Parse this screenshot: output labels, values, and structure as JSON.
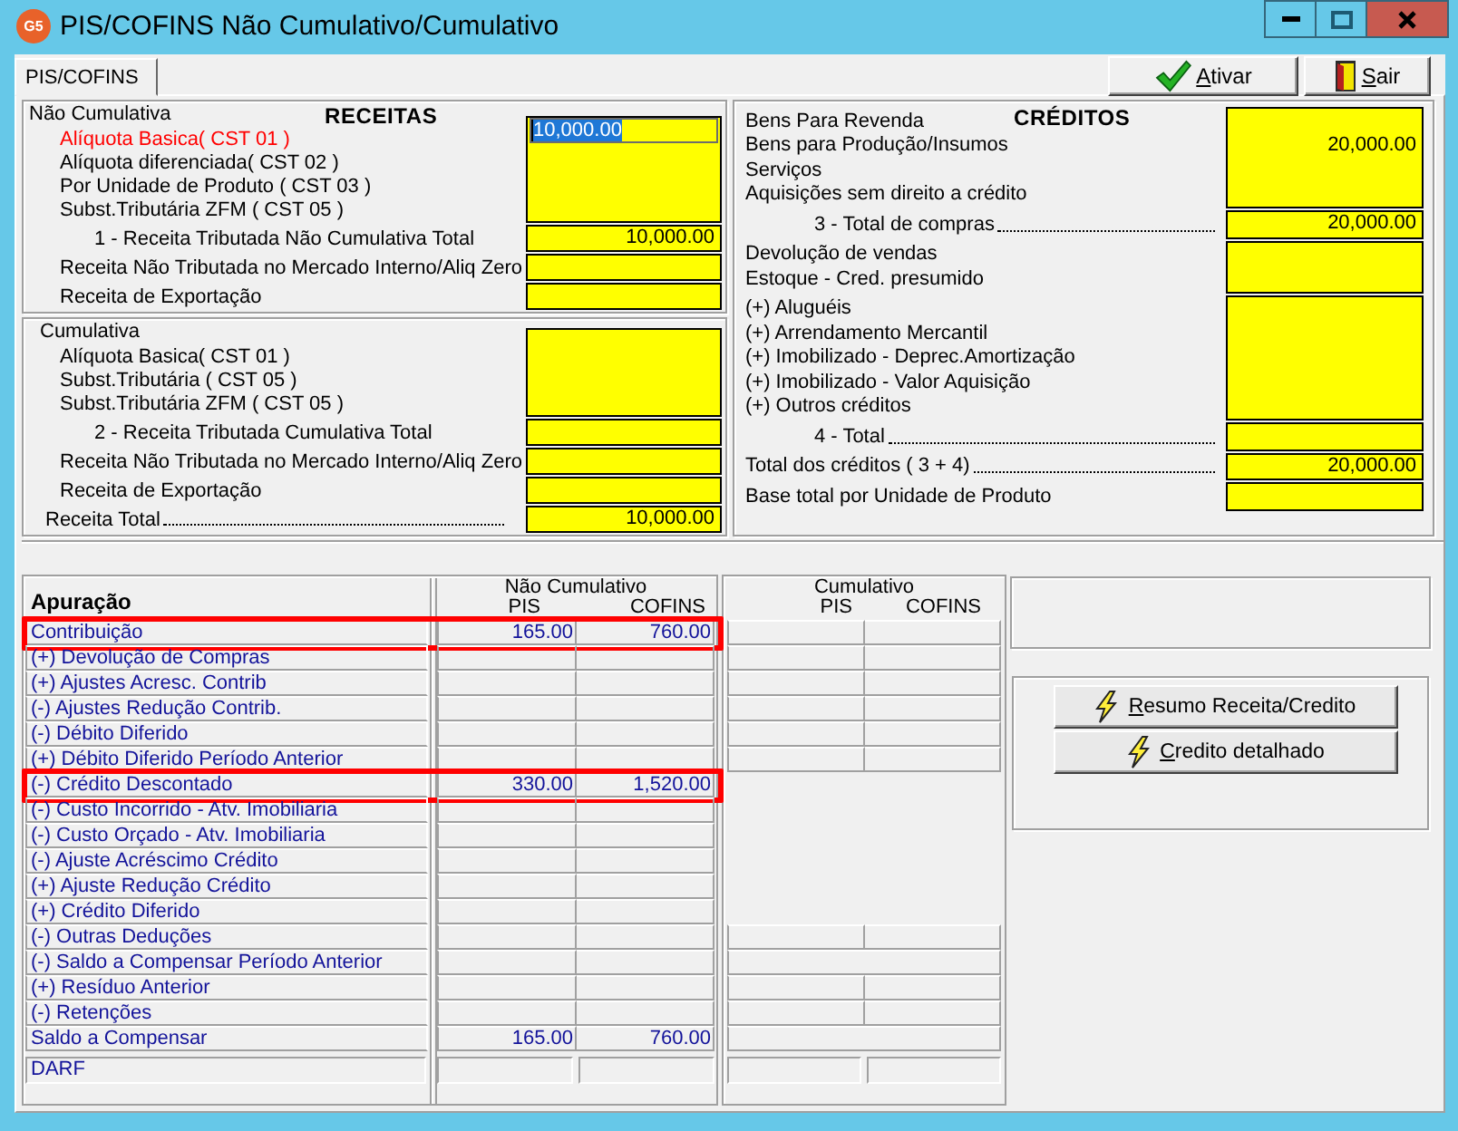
{
  "window": {
    "logo": "G5",
    "title": "PIS/COFINS Não Cumulativo/Cumulativo"
  },
  "tabs": [
    {
      "label": "PIS/COFINS",
      "selected": true
    }
  ],
  "toolbar": [
    {
      "kind": "check",
      "label": "Ativar",
      "mnemonic": true
    },
    {
      "kind": "door",
      "label": "Sair",
      "mnemonic": true
    }
  ],
  "receitas": {
    "title": "RECEITAS",
    "groups": [
      {
        "label": "Não Cumulativa",
        "sections": [
          [
            {
              "kind": "line",
              "label": "Alíquota Basica( CST 01 )",
              "focused": true,
              "value": "10,000.00"
            },
            {
              "kind": "line",
              "label": "Alíquota diferenciada( CST 02 )",
              "focused": false
            },
            {
              "kind": "line",
              "label": "Por Unidade de Produto ( CST 03 )",
              "focused": false
            },
            {
              "kind": "line",
              "label": "Subst.Tributária ZFM ( CST 05 )",
              "focused": false
            }
          ],
          [
            {
              "kind": "sum",
              "label": "1 - Receita Tributada Não Cumulativa Total",
              "value": "10,000.00"
            }
          ],
          [
            {
              "kind": "line",
              "label": "Receita Não Tributada no Mercado Interno/Aliq Zero"
            }
          ],
          [
            {
              "kind": "line",
              "label": "Receita de Exportação"
            }
          ]
        ]
      },
      {
        "label": "Cumulativa",
        "sections": [
          [
            {
              "kind": "line",
              "label": "Alíquota Basica( CST 01 )"
            },
            {
              "kind": "line",
              "label": "Subst.Tributária ( CST 05 )"
            },
            {
              "kind": "line",
              "label": "Subst.Tributária ZFM ( CST 05 )"
            }
          ],
          [
            {
              "kind": "sum",
              "label": "2 - Receita Tributada Cumulativa Total"
            }
          ],
          [
            {
              "kind": "line",
              "label": "Receita Não Tributada no Mercado Interno/Aliq Zero"
            }
          ],
          [
            {
              "kind": "line",
              "label": "Receita de Exportação"
            }
          ],
          [
            {
              "kind": "linedots",
              "label": "Receita Total",
              "value": "10,000.00"
            }
          ]
        ]
      }
    ]
  },
  "creditos": {
    "title": "CRÉDITOS",
    "sections": [
      [
        {
          "kind": "line",
          "label": "Bens Para Revenda"
        },
        {
          "kind": "line",
          "label": "Bens para Produção/Insumos",
          "value": "20,000.00"
        },
        {
          "kind": "line",
          "label": "Serviços"
        },
        {
          "kind": "line",
          "label": "Aquisições sem direito a crédito"
        }
      ],
      [
        {
          "kind": "sumdots",
          "label": "3 - Total de compras",
          "value": "20,000.00"
        }
      ],
      [
        {
          "kind": "line",
          "label": "Devolução de vendas"
        },
        {
          "kind": "line",
          "label": "Estoque - Cred. presumido"
        }
      ],
      [
        {
          "kind": "line",
          "label": "(+) Aluguéis"
        },
        {
          "kind": "line",
          "label": "(+) Arrendamento Mercantil"
        },
        {
          "kind": "line",
          "label": "(+) Imobilizado - Deprec.Amortização"
        },
        {
          "kind": "line",
          "label": "(+) Imobilizado - Valor Aquisição"
        },
        {
          "kind": "line",
          "label": "(+) Outros créditos"
        }
      ],
      [
        {
          "kind": "sumdots",
          "label": "4 - Total"
        }
      ],
      [
        {
          "kind": "linedots",
          "label": "Total dos créditos ( 3 + 4)",
          "value": "20,000.00"
        }
      ],
      [
        {
          "kind": "line",
          "label": "Base total por Unidade de Produto"
        }
      ]
    ]
  },
  "apuracao": {
    "title": "Apuração",
    "nao_cumulativo": {
      "title": "Não Cumulativo",
      "columns": [
        "PIS",
        "COFINS"
      ]
    },
    "cumulativo": {
      "title": "Cumulativo",
      "columns": [
        "PIS",
        "COFINS"
      ]
    },
    "rows": [
      {
        "label": "Contribuição",
        "pis": "165.00",
        "cofins": "760.00",
        "highlighted": true,
        "kind": "split"
      },
      {
        "label": "(+) Devolução de Compras",
        "highlighted": false,
        "kind": "split"
      },
      {
        "label": "(+) Ajustes Acresc. Contrib",
        "highlighted": false,
        "kind": "split"
      },
      {
        "label": "(-) Ajustes Redução Contrib.",
        "highlighted": false,
        "kind": "split"
      },
      {
        "label": "(-) Débito Diferido",
        "highlighted": false,
        "kind": "split"
      },
      {
        "label": "(+) Débito Diferido Período Anterior",
        "highlighted": false,
        "kind": "split"
      },
      {
        "label": "(-) Crédito Descontado",
        "pis": "330.00",
        "cofins": "1,520.00",
        "highlighted": true,
        "kind": "blank"
      },
      {
        "label": "(-) Custo Incorrido - Atv. Imobiliaria",
        "highlighted": false,
        "kind": "blank"
      },
      {
        "label": "(-) Custo Orçado - Atv. Imobiliaria",
        "highlighted": false,
        "kind": "blank"
      },
      {
        "label": "(-) Ajuste Acréscimo Crédito",
        "highlighted": false,
        "kind": "blank"
      },
      {
        "label": "(+) Ajuste Redução Crédito",
        "highlighted": false,
        "kind": "blank"
      },
      {
        "label": "(+) Crédito Diferido",
        "highlighted": false,
        "kind": "blank"
      },
      {
        "label": "(-) Outras Deduções",
        "highlighted": false,
        "kind": "split"
      },
      {
        "label": "(-) Saldo a Compensar Período Anterior",
        "highlighted": false,
        "kind": "merged"
      },
      {
        "label": "(+) Resíduo Anterior",
        "highlighted": false,
        "kind": "split"
      },
      {
        "label": "(-) Retenções",
        "highlighted": false,
        "kind": "split"
      },
      {
        "label": "Saldo a Compensar",
        "pis": "165.00",
        "cofins": "760.00",
        "highlighted": false,
        "kind": "merged"
      }
    ],
    "darf": {
      "label": "DARF"
    }
  },
  "actions": [
    {
      "label": "Resumo Receita/Credito",
      "mnemonic": true
    },
    {
      "label": "Credito detalhado",
      "mnemonic": true
    }
  ]
}
